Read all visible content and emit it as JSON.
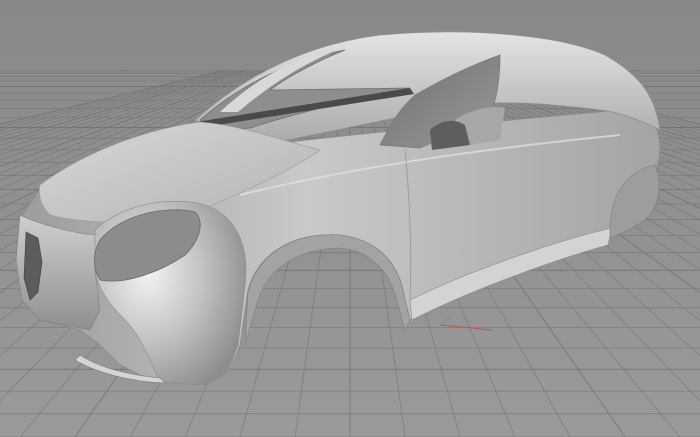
{
  "viewport": {
    "background": "#8a8a8a",
    "grid_line_color": "#7a7a7a",
    "grid_major_color": "#6e6e6e",
    "model_base_color": "#bdbdbd",
    "model_highlight_color": "#e6e6e6",
    "model_shadow_color": "#7d7d7d",
    "axis_x_color": "#c85050",
    "axis_y_color": "#9a7d7d"
  },
  "objects": [
    {
      "name": "car-body-shell",
      "icon": "car-body-icon"
    },
    {
      "name": "construction-plane-grid",
      "icon": "grid-icon"
    },
    {
      "name": "world-axes",
      "icon": "axes-icon"
    }
  ]
}
